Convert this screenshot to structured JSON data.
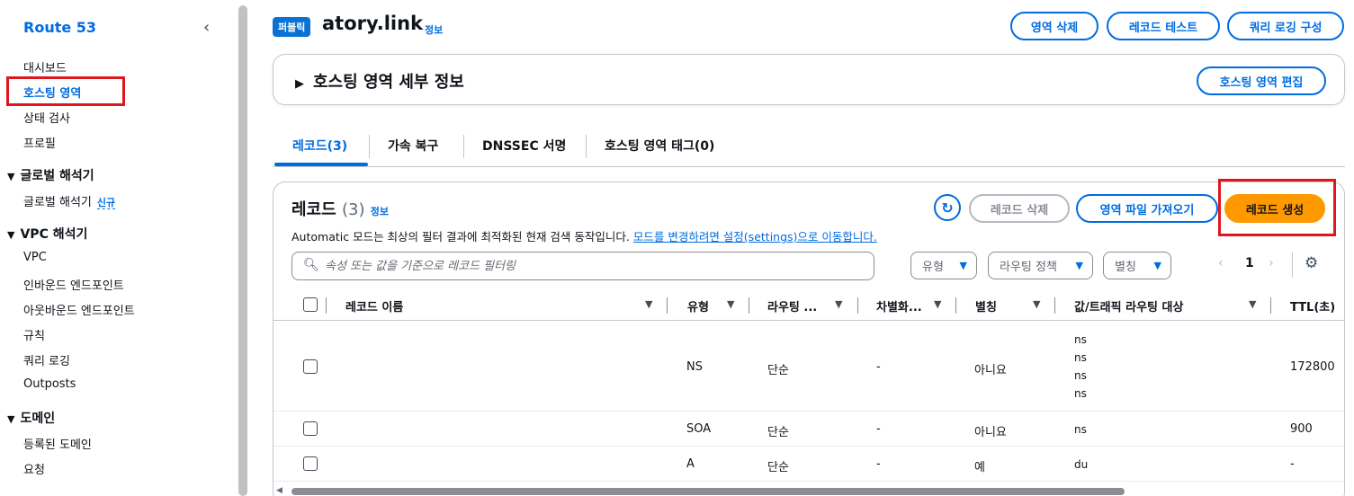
{
  "sidebar": {
    "title": "Route 53",
    "collapse_icon": "chevron-left-icon",
    "items": [
      {
        "label": "대시보드"
      },
      {
        "label": "호스팅 영역"
      },
      {
        "label": "상태 검사"
      },
      {
        "label": "프로필"
      }
    ],
    "sections": [
      {
        "label": "글로벌 해석기",
        "items": [
          {
            "label": "글로벌 해석기",
            "badge": "신규"
          }
        ]
      },
      {
        "label": "VPC 해석기",
        "items": [
          {
            "label": "VPC"
          },
          {
            "label": "인바운드 엔드포인트"
          },
          {
            "label": "아웃바운드 엔드포인트"
          },
          {
            "label": "규칙"
          },
          {
            "label": "쿼리 로깅"
          },
          {
            "label": "Outposts"
          }
        ]
      },
      {
        "label": "도메인",
        "items": [
          {
            "label": "등록된 도메인"
          },
          {
            "label": "요청"
          }
        ]
      }
    ]
  },
  "header": {
    "badge": "퍼블릭",
    "title": "atory.link",
    "info": "정보",
    "buttons": {
      "delete_zone": "영역 삭제",
      "test_record": "레코드 테스트",
      "query_logging": "쿼리 로깅 구성"
    }
  },
  "details_panel": {
    "title": "호스팅 영역 세부 정보",
    "edit_button": "호스팅 영역 편집"
  },
  "tabs": [
    {
      "label": "레코드(3)"
    },
    {
      "label": "가속 복구"
    },
    {
      "label": "DNSSEC 서명"
    },
    {
      "label": "호스팅 영역 태그(0)"
    }
  ],
  "records": {
    "title": "레코드",
    "count": "(3)",
    "info": "정보",
    "description": "Automatic 모드는 최상의 필터 결과에 최적화된 현재 검색 동작입니다.",
    "description_link": "모드를 변경하려면 설정(settings)으로 이동합니다.",
    "buttons": {
      "delete": "레코드 삭제",
      "import": "영역 파일 가져오기",
      "create": "레코드 생성"
    },
    "search_placeholder": "속성 또는 값을 기준으로 레코드 필터링",
    "filters": {
      "type": "유형",
      "routing": "라우팅 정책",
      "alias": "별칭"
    },
    "pager": {
      "page": "1"
    },
    "columns": [
      "레코드 이름",
      "유형",
      "라우팅 ...",
      "차별화...",
      "별칭",
      "값/트래픽 라우팅 대상",
      "TTL(초)"
    ],
    "rows": [
      {
        "name": "",
        "type": "NS",
        "routing": "단순",
        "diff": "-",
        "alias": "아니요",
        "values": [
          "ns",
          "ns",
          "ns",
          "ns"
        ],
        "ttl": "172800"
      },
      {
        "name": "",
        "type": "SOA",
        "routing": "단순",
        "diff": "-",
        "alias": "아니요",
        "values": [
          "ns"
        ],
        "ttl": "900"
      },
      {
        "name": "",
        "type": "A",
        "routing": "단순",
        "diff": "-",
        "alias": "예",
        "values": [
          "du"
        ],
        "ttl": "-"
      }
    ]
  }
}
